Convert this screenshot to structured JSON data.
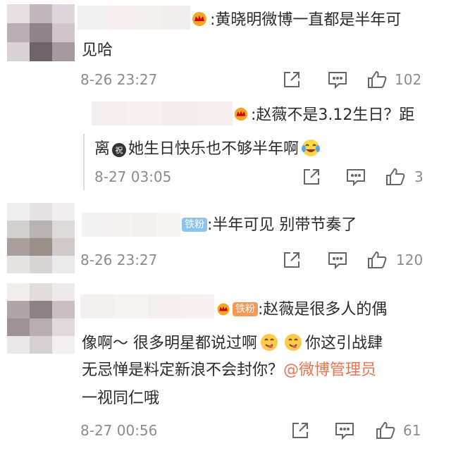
{
  "comments": [
    {
      "id": "c1",
      "line1": ":黄晓明微博一直都是半年可",
      "line2": "见哈",
      "time": "8-26 23:27",
      "likes": "102"
    },
    {
      "id": "c1-reply",
      "line1": ":赵薇不是3.12生日？距",
      "line2_before": "离",
      "line2_after": "她生日快乐也不够半年啊",
      "time": "8-27 03:05",
      "likes": "3"
    },
    {
      "id": "c2",
      "badge": "铁粉",
      "line1": ":半年可见 别带节奏了",
      "time": "8-26 23:27",
      "likes": "120"
    },
    {
      "id": "c3",
      "badge": "铁粉",
      "line1": ":赵薇是很多人的偶",
      "line2_a": "像啊～ 很多明星都说过啊",
      "line2_b": "你这引战肆",
      "line3_a": "无忌惮是料定新浪不会封你？",
      "mention": "@微博管理员",
      "line4": "一视同仁哦",
      "time": "8-27 00:56",
      "likes": "61"
    }
  ],
  "colors": {
    "accent_link": "#eb7350",
    "meta_gray": "#8c8c8c",
    "badge_blue": "#8cc3ee",
    "badge_orange": "#f39a58"
  },
  "icons": [
    "crown-icon",
    "share-icon",
    "reply-icon",
    "like-icon",
    "laugh-cry-emoji",
    "yummy-emoji",
    "zhu-mask-icon"
  ]
}
